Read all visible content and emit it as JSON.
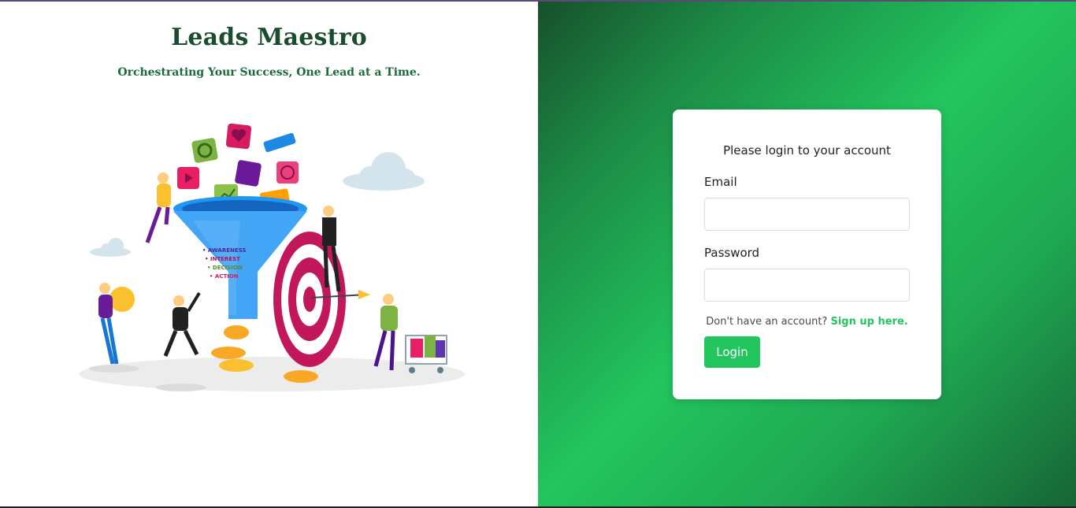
{
  "brand": {
    "title": "Leads Maestro",
    "tagline": "Orchestrating Your Success, One Lead at a Time."
  },
  "illustration": {
    "funnel_stages": [
      "AWARENESS",
      "INTEREST",
      "DECISION",
      "ACTION"
    ]
  },
  "login": {
    "heading": "Please login to your account",
    "email_label": "Email",
    "email_value": "",
    "password_label": "Password",
    "password_value": "",
    "signup_prompt": "Don't have an account? ",
    "signup_link": "Sign up here.",
    "login_button": "Login"
  },
  "colors": {
    "brand_dark": "#1a4d2e",
    "accent": "#22c55e",
    "gradient_dark": "#17502b"
  }
}
